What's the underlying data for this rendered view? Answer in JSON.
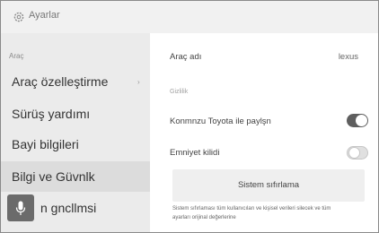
{
  "window": {
    "title": "Ayarlar"
  },
  "sidebar": {
    "section_label": "Araç",
    "items": [
      {
        "label": "Araç özelleştirme"
      },
      {
        "label": "Sürüş yardımı"
      },
      {
        "label": "Bayi bilgileri"
      },
      {
        "label": "Bilgi ve Güvnlk"
      },
      {
        "label": "n gncllmsi"
      }
    ]
  },
  "main": {
    "vehicle_name_label": "Araç adı",
    "vehicle_name_value": "lexus",
    "privacy_header": "Gizlilik",
    "share_label": "Konmnzu Toyota ile paylşn",
    "share_enabled": true,
    "safety_lock_label": "Emniyet kilidi",
    "safety_lock_enabled": false,
    "reset_button_label": "Sistem sıfırlama",
    "reset_description": "Sistem sıfırlaması tüm kullanıcıları ve kişisel verileri silecek ve tüm ayarları orijinal değerlerine"
  }
}
